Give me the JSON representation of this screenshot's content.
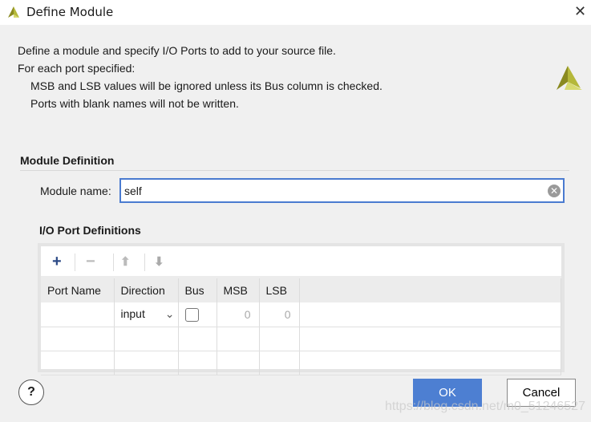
{
  "window": {
    "title": "Define Module",
    "close_icon": "close-icon"
  },
  "description": {
    "line1": "Define a module and specify I/O Ports to add to your source file.",
    "line2": "For each port specified:",
    "line3": "MSB and LSB values will be ignored unless its Bus column is checked.",
    "line4": "Ports with blank names will not be written."
  },
  "module_definition": {
    "heading": "Module Definition",
    "name_label": "Module name:",
    "name_value": "self"
  },
  "io_ports": {
    "heading": "I/O Port Definitions",
    "toolbar": {
      "add": "+",
      "remove": "−",
      "up": "⬆",
      "down": "⬇"
    },
    "columns": [
      "Port Name",
      "Direction",
      "Bus",
      "MSB",
      "LSB"
    ],
    "rows": [
      {
        "port_name": "",
        "direction": "input",
        "bus": false,
        "msb": "0",
        "lsb": "0"
      }
    ]
  },
  "buttons": {
    "help": "?",
    "ok": "OK",
    "cancel": "Cancel"
  },
  "watermark": "https://blog.csdn.net/m0_51246527",
  "colors": {
    "accent": "#4d7fd2",
    "logo": "#b5b83a"
  }
}
